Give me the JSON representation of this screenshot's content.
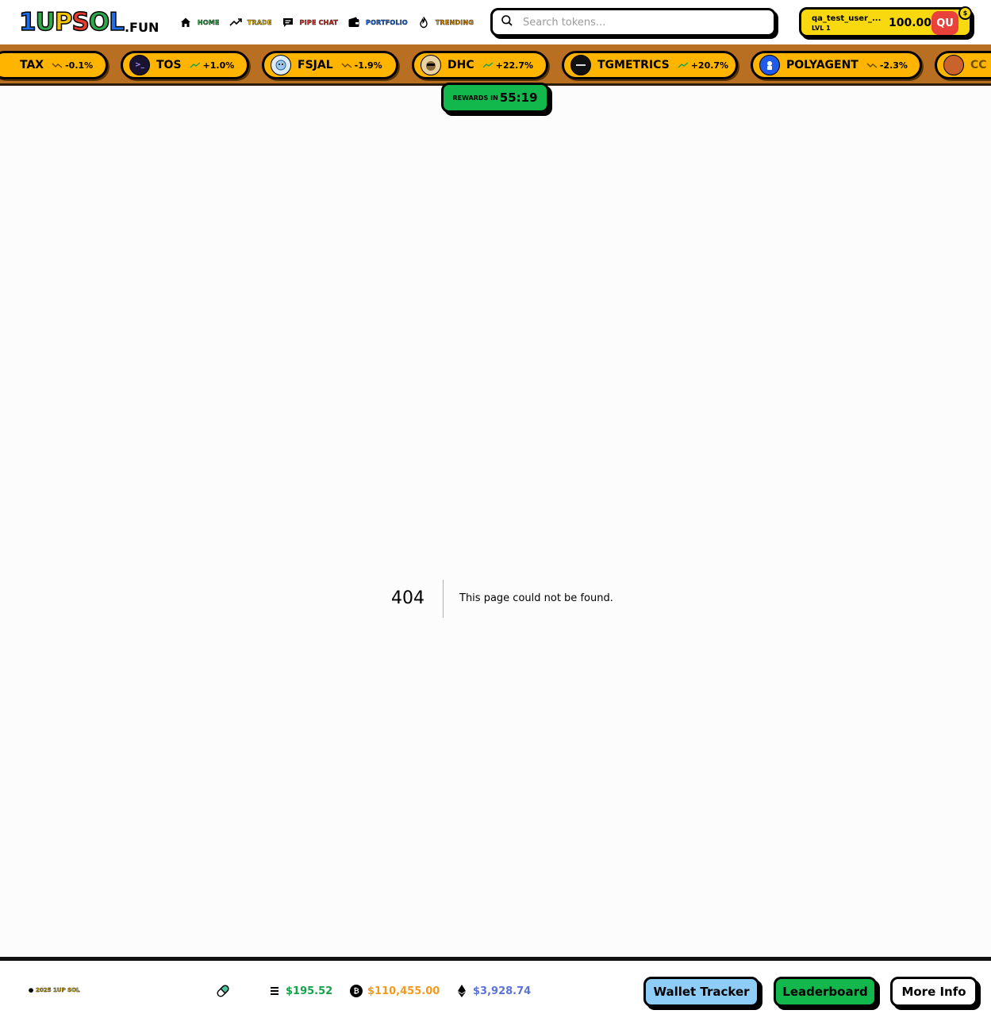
{
  "header": {
    "logo_main": [
      "1",
      "U",
      "P",
      "S",
      "O",
      "L"
    ],
    "logo_suffix": ".FUN",
    "nav": [
      {
        "label": "HOME",
        "icon": "home-icon"
      },
      {
        "label": "TRADE",
        "icon": "trend-up-icon"
      },
      {
        "label": "PIPE CHAT",
        "icon": "chat-icon"
      },
      {
        "label": "PORTFOLIO",
        "icon": "wallet-icon"
      },
      {
        "label": "TRENDING",
        "icon": "flame-icon"
      }
    ],
    "search_placeholder": "Search tokens...",
    "user": {
      "name": "qa_test_user_...",
      "level": "LVL 1",
      "balance": "100.00",
      "avatar": "QU",
      "badge": "$"
    }
  },
  "ticker": [
    {
      "name": "TAX",
      "change": "-0.1%",
      "direction": "down",
      "icon_color": "#7a7a7a",
      "icon_text": ""
    },
    {
      "name": "TOS",
      "change": "+1.0%",
      "direction": "up",
      "icon_color": "#1a1433",
      "icon_text": ">_"
    },
    {
      "name": "FSJAL",
      "change": "-1.9%",
      "direction": "down",
      "icon_color": "#dbeaf7",
      "icon_text": ""
    },
    {
      "name": "DHC",
      "change": "+22.7%",
      "direction": "up",
      "icon_color": "#e8d2a3",
      "icon_text": ""
    },
    {
      "name": "TGMETRICS",
      "change": "+20.7%",
      "direction": "up",
      "icon_color": "#111111",
      "icon_text": ""
    },
    {
      "name": "POLYAGENT",
      "change": "-2.3%",
      "direction": "down",
      "icon_color": "#1f5be8",
      "icon_text": ""
    },
    {
      "name": "CC",
      "change": "",
      "direction": "",
      "icon_color": "#c9622b",
      "icon_text": ""
    }
  ],
  "rewards": {
    "label": "REWARDS IN",
    "time": "55:19"
  },
  "not_found": {
    "code": "404",
    "message": "This page could not be found."
  },
  "footer": {
    "copyright": "2025 1UP SOL",
    "prices": {
      "sol": "$195.52",
      "btc": "$110,455.00",
      "eth": "$3,928.74"
    },
    "buttons": {
      "wallet_tracker": "Wallet Tracker",
      "leaderboard": "Leaderboard",
      "more_info": "More Info"
    }
  },
  "colors": {
    "ticker_bg": "#b96f22",
    "chip_bg": "#ffb400",
    "rewards_bg": "#12b84b",
    "user_box_bg": "#f8d90f",
    "avatar_bg": "#e8423b",
    "up": "#16a34a",
    "down": "#6b4a00",
    "sol": "#17a34a",
    "btc": "#f29a1e",
    "eth": "#5b73d9"
  }
}
